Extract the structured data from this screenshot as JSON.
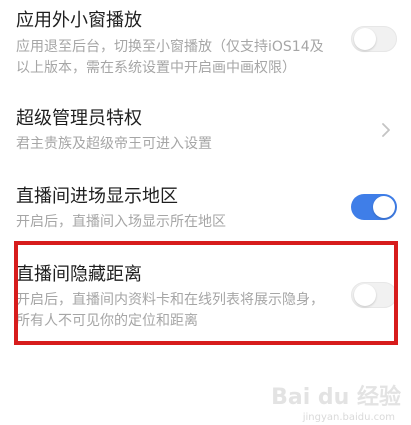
{
  "settings": [
    {
      "title": "应用外小窗播放",
      "desc_lines": [
        "应用退至后台，切换至小窗播放（仅支持iOS14及",
        "以上版本，需在系统设置中开启画中画权限）"
      ],
      "control": "toggle",
      "enabled": false
    },
    {
      "title": "超级管理员特权",
      "desc_lines": [
        "君主贵族及超级帝王可进入设置"
      ],
      "control": "chevron"
    },
    {
      "title": "直播间进场显示地区",
      "desc_lines": [
        "开启后，直播间入场显示所在地区"
      ],
      "control": "toggle",
      "enabled": true
    },
    {
      "title": "直播间隐藏距离",
      "desc_lines": [
        "开启后，直播间内资料卡和在线列表将展示隐身，",
        "所有人不可见你的定位和距离"
      ],
      "control": "toggle",
      "enabled": false
    }
  ],
  "watermark": {
    "logo": "Bai du 经验",
    "url": "jingyan.baidu.com"
  },
  "colors": {
    "toggle_on": "#3f7ee8",
    "toggle_off": "#f1f1f1",
    "highlight_border": "#d71c1c",
    "title": "#1f1f1f",
    "desc": "#a6a6a6"
  }
}
